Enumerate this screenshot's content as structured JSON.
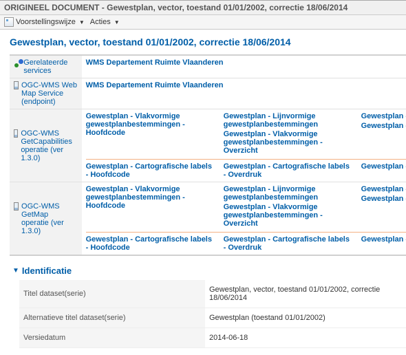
{
  "header": {
    "title": "ORIGINEEL DOCUMENT - Gewestplan, vector, toestand 01/01/2002, correctie 18/06/2014"
  },
  "toolbar": {
    "view_mode": "Voorstellingswijze",
    "actions": "Acties"
  },
  "main": {
    "title": "Gewestplan, vector, toestand 01/01/2002, correctie 18/06/2014",
    "related_services_label": "Gerelateerde services",
    "wms_header": "WMS Departement Ruimte Vlaanderen",
    "rows": {
      "wms_endpoint": {
        "label": "OGC-WMS Web Map Service (endpoint)",
        "link": "WMS Departement Ruimte Vlaanderen"
      },
      "getcaps": {
        "label": "OGC-WMS GetCapabilities operatie (ver 1.3.0)",
        "row1": {
          "a": "Gewestplan - Vlakvormige gewestplanbestemmingen - Hoofdcode",
          "b": "Gewestplan - Lijnvormige gewestplanbestemmingen",
          "c": "Gewestplan - Lijnvormige gewestplanbestemmingen",
          "d": "Gewestplan - Vlakvormige gewestplanbestemmingen - Overzicht",
          "e": "Gewestplan - Vlakvormige gewestplanbestemmingen"
        },
        "row2": {
          "a": "Gewestplan - Cartografische labels - Hoofdcode",
          "b": "Gewestplan - Cartografische labels - Overdruk",
          "c": "Gewestplan - Cartografische labels - Grondkleur"
        }
      },
      "getmap": {
        "label": "OGC-WMS GetMap operatie (ver 1.3.0)",
        "row1": {
          "a": "Gewestplan - Vlakvormige gewestplanbestemmingen - Hoofdcode",
          "b": "Gewestplan - Lijnvormige gewestplanbestemmingen",
          "c": "Gewestplan - Lijnvormige gewestplanbestemmingen",
          "d": "Gewestplan - Vlakvormige gewestplanbestemmingen - Overzicht",
          "e": "Gewestplan - Vlakvormige gewestplanbestemmingen"
        },
        "row2": {
          "a": "Gewestplan - Cartografische labels - Hoofdcode",
          "b": "Gewestplan - Cartografische labels - Overdruk",
          "c": "Gewestplan - Cartografische labels - Grondkleur"
        }
      }
    }
  },
  "identification": {
    "section_label": "Identificatie",
    "fields": {
      "title_label": "Titel dataset(serie)",
      "title_value": "Gewestplan, vector, toestand 01/01/2002, correctie 18/06/2014",
      "alt_title_label": "Alternatieve titel dataset(serie)",
      "alt_title_value": "Gewestplan (toestand 01/01/2002)",
      "version_date_label": "Versiedatum",
      "version_date_value": "2014-06-18"
    }
  }
}
